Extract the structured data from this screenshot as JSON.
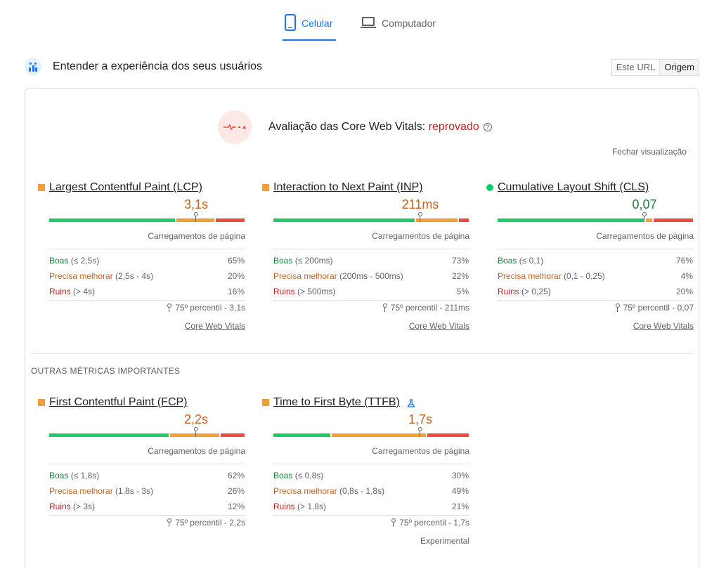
{
  "tabs": {
    "mobile": "Celular",
    "desktop": "Computador"
  },
  "section": {
    "title": "Entender a experiência dos seus usuários"
  },
  "url_toggle": {
    "this_url": "Este URL",
    "origin": "Origem"
  },
  "assessment": {
    "prefix": "Avaliação das Core Web Vitals:",
    "status": "reprovado",
    "collapse": "Fechar visualização"
  },
  "common": {
    "page_loads": "Carregamentos de página",
    "good": "Boas",
    "needs_improvement": "Precisa melhorar",
    "poor": "Ruins",
    "cwv_link": "Core Web Vitals",
    "experimental": "Experimental"
  },
  "other_title": "OUTRAS MÉTRICAS IMPORTANTES",
  "metrics": {
    "lcp": {
      "name": "Largest Contentful Paint (LCP)",
      "value": "3,1s",
      "status": "needs-improvement",
      "dist": [
        0.65,
        0.2,
        0.16
      ],
      "marker": 0.75,
      "good_range": "(≤ 2,5s)",
      "ni_range": "(2,5s - 4s)",
      "poor_range": "(> 4s)",
      "good_pct": "65%",
      "ni_pct": "20%",
      "poor_pct": "16%",
      "percentile": "75º percentil - 3,1s"
    },
    "inp": {
      "name": "Interaction to Next Paint (INP)",
      "value": "211ms",
      "status": "needs-improvement",
      "dist": [
        0.73,
        0.22,
        0.05
      ],
      "marker": 0.75,
      "good_range": "(≤ 200ms)",
      "ni_range": "(200ms - 500ms)",
      "poor_range": "(> 500ms)",
      "good_pct": "73%",
      "ni_pct": "22%",
      "poor_pct": "5%",
      "percentile": "75º percentil - 211ms"
    },
    "cls": {
      "name": "Cumulative Layout Shift (CLS)",
      "value": "0,07",
      "status": "good",
      "dist": [
        0.76,
        0.04,
        0.2
      ],
      "marker": 0.75,
      "good_range": "(≤ 0,1)",
      "ni_range": "(0,1 - 0,25)",
      "poor_range": "(> 0,25)",
      "good_pct": "76%",
      "ni_pct": "4%",
      "poor_pct": "20%",
      "percentile": "75º percentil - 0,07"
    },
    "fcp": {
      "name": "First Contentful Paint (FCP)",
      "value": "2,2s",
      "status": "needs-improvement",
      "dist": [
        0.62,
        0.26,
        0.12
      ],
      "marker": 0.75,
      "good_range": "(≤ 1,8s)",
      "ni_range": "(1,8s - 3s)",
      "poor_range": "(> 3s)",
      "good_pct": "62%",
      "ni_pct": "26%",
      "poor_pct": "12%",
      "percentile": "75º percentil - 2,2s"
    },
    "ttfb": {
      "name": "Time to First Byte (TTFB)",
      "value": "1,7s",
      "status": "needs-improvement",
      "dist": [
        0.3,
        0.49,
        0.21
      ],
      "marker": 0.75,
      "good_range": "(≤ 0,8s)",
      "ni_range": "(0,8s - 1,8s)",
      "poor_range": "(> 1,8s)",
      "good_pct": "30%",
      "ni_pct": "49%",
      "poor_pct": "21%",
      "percentile": "75º percentil - 1,7s"
    }
  },
  "colors": {
    "accent": "#1a73e8",
    "good": "#0cce6b",
    "needs_improvement": "#f29d37",
    "poor": "#ee4b3d",
    "fail_text": "#c5221f"
  },
  "icons": [
    "phone-icon",
    "laptop-icon",
    "users-icon",
    "assessment-icon",
    "help-icon",
    "pin-icon",
    "flask-icon"
  ]
}
